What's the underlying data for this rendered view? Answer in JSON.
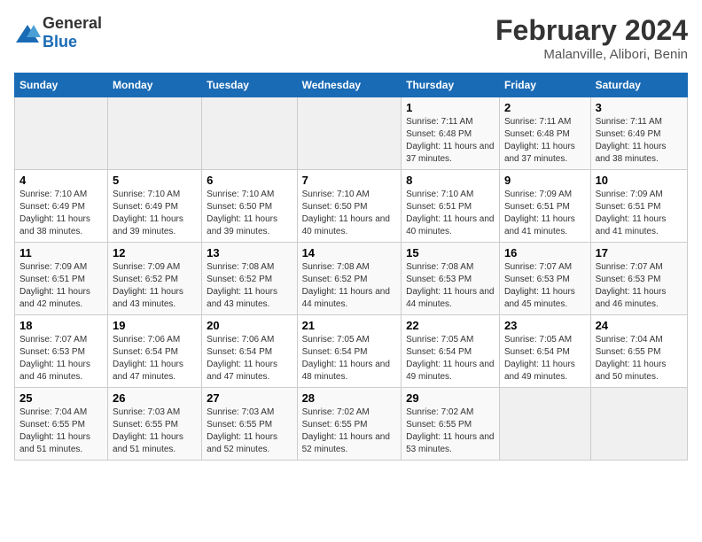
{
  "logo": {
    "general": "General",
    "blue": "Blue"
  },
  "title": "February 2024",
  "subtitle": "Malanville, Alibori, Benin",
  "days_of_week": [
    "Sunday",
    "Monday",
    "Tuesday",
    "Wednesday",
    "Thursday",
    "Friday",
    "Saturday"
  ],
  "weeks": [
    [
      {
        "day": "",
        "empty": true
      },
      {
        "day": "",
        "empty": true
      },
      {
        "day": "",
        "empty": true
      },
      {
        "day": "",
        "empty": true
      },
      {
        "day": "1",
        "sunrise": "7:11 AM",
        "sunset": "6:48 PM",
        "daylight": "11 hours and 37 minutes."
      },
      {
        "day": "2",
        "sunrise": "7:11 AM",
        "sunset": "6:48 PM",
        "daylight": "11 hours and 37 minutes."
      },
      {
        "day": "3",
        "sunrise": "7:11 AM",
        "sunset": "6:49 PM",
        "daylight": "11 hours and 38 minutes."
      }
    ],
    [
      {
        "day": "4",
        "sunrise": "7:10 AM",
        "sunset": "6:49 PM",
        "daylight": "11 hours and 38 minutes."
      },
      {
        "day": "5",
        "sunrise": "7:10 AM",
        "sunset": "6:49 PM",
        "daylight": "11 hours and 39 minutes."
      },
      {
        "day": "6",
        "sunrise": "7:10 AM",
        "sunset": "6:50 PM",
        "daylight": "11 hours and 39 minutes."
      },
      {
        "day": "7",
        "sunrise": "7:10 AM",
        "sunset": "6:50 PM",
        "daylight": "11 hours and 40 minutes."
      },
      {
        "day": "8",
        "sunrise": "7:10 AM",
        "sunset": "6:51 PM",
        "daylight": "11 hours and 40 minutes."
      },
      {
        "day": "9",
        "sunrise": "7:09 AM",
        "sunset": "6:51 PM",
        "daylight": "11 hours and 41 minutes."
      },
      {
        "day": "10",
        "sunrise": "7:09 AM",
        "sunset": "6:51 PM",
        "daylight": "11 hours and 41 minutes."
      }
    ],
    [
      {
        "day": "11",
        "sunrise": "7:09 AM",
        "sunset": "6:51 PM",
        "daylight": "11 hours and 42 minutes."
      },
      {
        "day": "12",
        "sunrise": "7:09 AM",
        "sunset": "6:52 PM",
        "daylight": "11 hours and 43 minutes."
      },
      {
        "day": "13",
        "sunrise": "7:08 AM",
        "sunset": "6:52 PM",
        "daylight": "11 hours and 43 minutes."
      },
      {
        "day": "14",
        "sunrise": "7:08 AM",
        "sunset": "6:52 PM",
        "daylight": "11 hours and 44 minutes."
      },
      {
        "day": "15",
        "sunrise": "7:08 AM",
        "sunset": "6:53 PM",
        "daylight": "11 hours and 44 minutes."
      },
      {
        "day": "16",
        "sunrise": "7:07 AM",
        "sunset": "6:53 PM",
        "daylight": "11 hours and 45 minutes."
      },
      {
        "day": "17",
        "sunrise": "7:07 AM",
        "sunset": "6:53 PM",
        "daylight": "11 hours and 46 minutes."
      }
    ],
    [
      {
        "day": "18",
        "sunrise": "7:07 AM",
        "sunset": "6:53 PM",
        "daylight": "11 hours and 46 minutes."
      },
      {
        "day": "19",
        "sunrise": "7:06 AM",
        "sunset": "6:54 PM",
        "daylight": "11 hours and 47 minutes."
      },
      {
        "day": "20",
        "sunrise": "7:06 AM",
        "sunset": "6:54 PM",
        "daylight": "11 hours and 47 minutes."
      },
      {
        "day": "21",
        "sunrise": "7:05 AM",
        "sunset": "6:54 PM",
        "daylight": "11 hours and 48 minutes."
      },
      {
        "day": "22",
        "sunrise": "7:05 AM",
        "sunset": "6:54 PM",
        "daylight": "11 hours and 49 minutes."
      },
      {
        "day": "23",
        "sunrise": "7:05 AM",
        "sunset": "6:54 PM",
        "daylight": "11 hours and 49 minutes."
      },
      {
        "day": "24",
        "sunrise": "7:04 AM",
        "sunset": "6:55 PM",
        "daylight": "11 hours and 50 minutes."
      }
    ],
    [
      {
        "day": "25",
        "sunrise": "7:04 AM",
        "sunset": "6:55 PM",
        "daylight": "11 hours and 51 minutes."
      },
      {
        "day": "26",
        "sunrise": "7:03 AM",
        "sunset": "6:55 PM",
        "daylight": "11 hours and 51 minutes."
      },
      {
        "day": "27",
        "sunrise": "7:03 AM",
        "sunset": "6:55 PM",
        "daylight": "11 hours and 52 minutes."
      },
      {
        "day": "28",
        "sunrise": "7:02 AM",
        "sunset": "6:55 PM",
        "daylight": "11 hours and 52 minutes."
      },
      {
        "day": "29",
        "sunrise": "7:02 AM",
        "sunset": "6:55 PM",
        "daylight": "11 hours and 53 minutes."
      },
      {
        "day": "",
        "empty": true
      },
      {
        "day": "",
        "empty": true
      }
    ]
  ]
}
